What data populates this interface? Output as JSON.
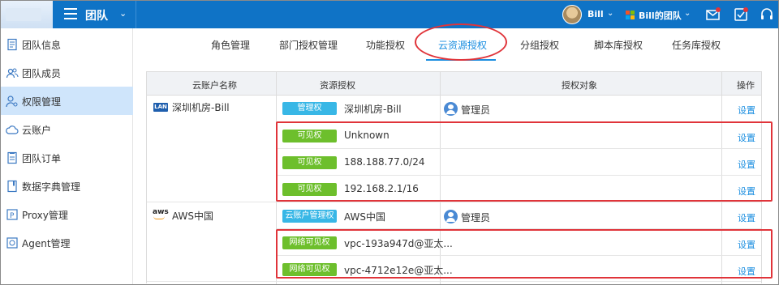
{
  "header": {
    "team_title": "团队",
    "user_name": "Bill",
    "team_switch": "Bill的团队",
    "brand_color": "#0f73c6"
  },
  "sidebar": {
    "items": [
      {
        "label": "团队信息",
        "icon": "document-icon"
      },
      {
        "label": "团队成员",
        "icon": "users-icon"
      },
      {
        "label": "权限管理",
        "icon": "user-key-icon",
        "active": true
      },
      {
        "label": "云账户",
        "icon": "cloud-icon"
      },
      {
        "label": "团队订单",
        "icon": "order-icon"
      },
      {
        "label": "数据字典管理",
        "icon": "book-icon"
      },
      {
        "label": "Proxy管理",
        "icon": "proxy-icon"
      },
      {
        "label": "Agent管理",
        "icon": "agent-icon"
      }
    ]
  },
  "tabs": [
    {
      "label": "角色管理"
    },
    {
      "label": "部门授权管理"
    },
    {
      "label": "功能授权"
    },
    {
      "label": "云资源授权",
      "active": true
    },
    {
      "label": "分组授权"
    },
    {
      "label": "脚本库授权"
    },
    {
      "label": "任务库授权"
    }
  ],
  "table": {
    "headers": [
      "云账户名称",
      "资源授权",
      "授权对象",
      "操作"
    ],
    "accounts": [
      {
        "logo": "LAN",
        "name": "深圳机房-Bill"
      },
      {
        "logo": "aws",
        "name": "AWS中国"
      }
    ],
    "rows": [
      {
        "badge": "管理权",
        "badge_color": "blue",
        "resource": "深圳机房-Bill",
        "target": "管理员",
        "action": "设置"
      },
      {
        "badge": "可见权",
        "badge_color": "green",
        "resource": "Unknown",
        "target": "",
        "action": "设置"
      },
      {
        "badge": "可见权",
        "badge_color": "green",
        "resource": "188.188.77.0/24",
        "target": "",
        "action": "设置"
      },
      {
        "badge": "可见权",
        "badge_color": "green",
        "resource": "192.168.2.1/16",
        "target": "",
        "action": "设置"
      },
      {
        "badge": "云账户管理权",
        "badge_color": "blue",
        "resource": "AWS中国",
        "target": "管理员",
        "action": "设置"
      },
      {
        "badge": "网络可见权",
        "badge_color": "green",
        "resource": "vpc-193a947d@亚太...",
        "target": "",
        "action": "设置"
      },
      {
        "badge": "网络可见权",
        "badge_color": "green",
        "resource": "vpc-4712e12e@亚太...",
        "target": "",
        "action": "设置"
      }
    ]
  }
}
